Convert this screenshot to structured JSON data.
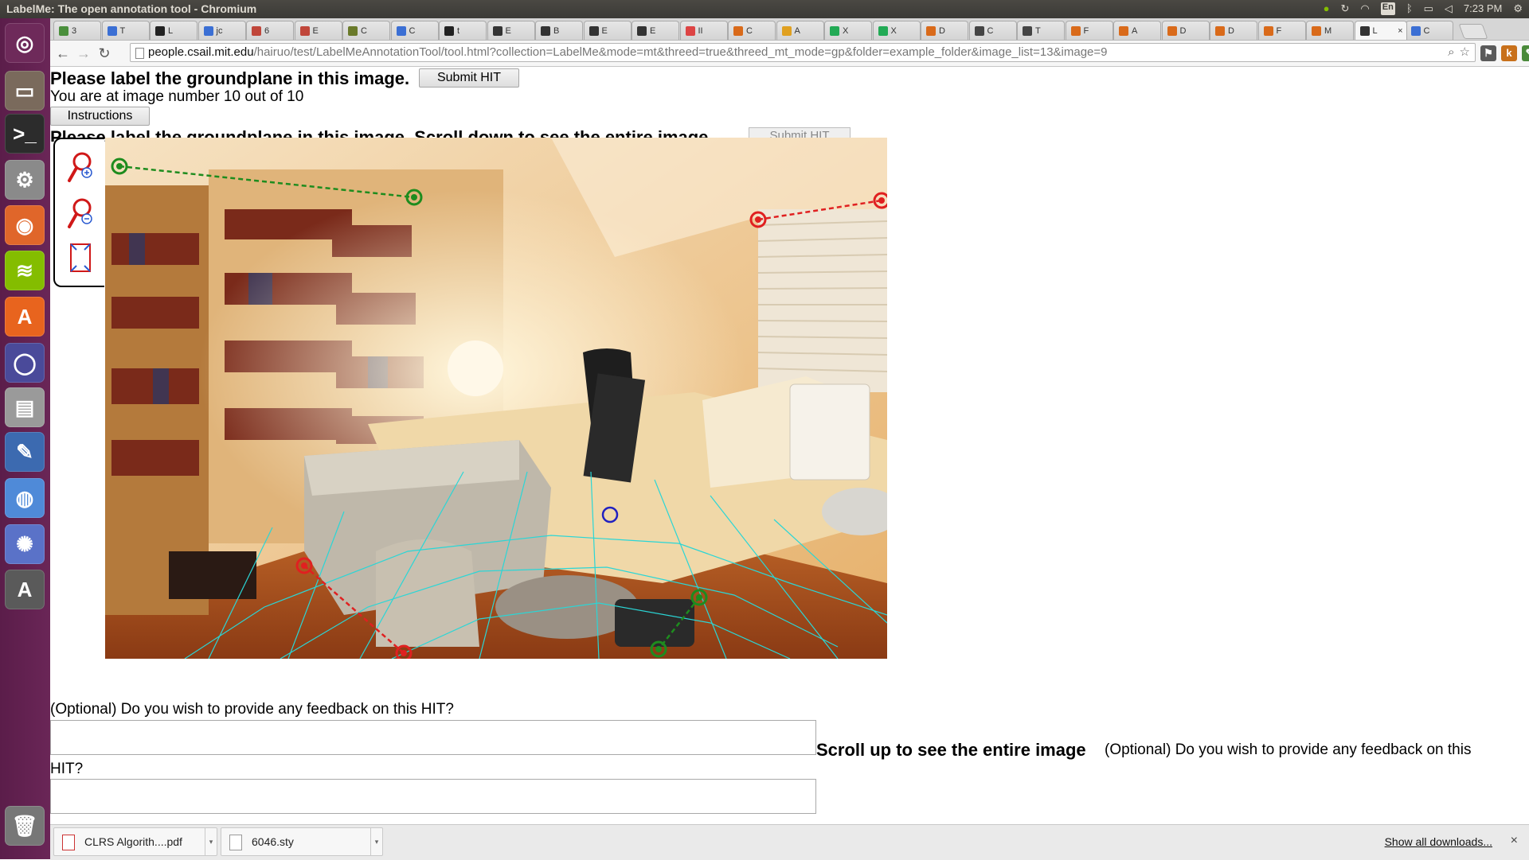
{
  "os": {
    "window_title": "LabelMe: The open annotation tool - Chromium",
    "keyboard_layout": "En",
    "clock": "7:23 PM"
  },
  "launcher": {
    "items": [
      {
        "name": "ubuntu-dash-icon",
        "glyph": "◎",
        "color": "#6e2a5a"
      },
      {
        "name": "files-icon",
        "glyph": "▭",
        "color": "#7a6a5c"
      },
      {
        "name": "terminal-icon",
        "glyph": ">_",
        "color": "#2c2c2c"
      },
      {
        "name": "settings-icon",
        "glyph": "⚙",
        "color": "#8a8a8a"
      },
      {
        "name": "firefox-icon",
        "glyph": "◉",
        "color": "#e0662a"
      },
      {
        "name": "spotify-icon",
        "glyph": "≋",
        "color": "#84bd00"
      },
      {
        "name": "software-center-icon",
        "glyph": "A",
        "color": "#e8641e"
      },
      {
        "name": "circle-app-icon",
        "glyph": "◯",
        "color": "#4a4a9a"
      },
      {
        "name": "disk-icon",
        "glyph": "▤",
        "color": "#9a9a9a"
      },
      {
        "name": "draw-app-icon",
        "glyph": "✎",
        "color": "#3c6ab0"
      },
      {
        "name": "chromium-icon",
        "glyph": "◍",
        "color": "#4f8ad8"
      },
      {
        "name": "pinwheel-icon",
        "glyph": "✺",
        "color": "#5a72c8"
      },
      {
        "name": "updater-icon",
        "glyph": "A",
        "color": "#5a5a5a"
      },
      {
        "name": "trash-icon",
        "glyph": "🗑",
        "color": "#777777"
      }
    ]
  },
  "tabs": [
    {
      "label": "3",
      "color": "#4a8f3c"
    },
    {
      "label": "T",
      "color": "#3b6fd4"
    },
    {
      "label": "L",
      "color": "#222"
    },
    {
      "label": "jc",
      "color": "#3b6fd4"
    },
    {
      "label": "6",
      "color": "#c0463a"
    },
    {
      "label": "E",
      "color": "#c0463a"
    },
    {
      "label": "C",
      "color": "#6a7a2a"
    },
    {
      "label": "C",
      "color": "#3b6fd4"
    },
    {
      "label": "t",
      "color": "#222"
    },
    {
      "label": "E",
      "color": "#333"
    },
    {
      "label": "B",
      "color": "#333"
    },
    {
      "label": "E",
      "color": "#333"
    },
    {
      "label": "E",
      "color": "#333"
    },
    {
      "label": "II",
      "color": "#d44"
    },
    {
      "label": "C",
      "color": "#d96a1a"
    },
    {
      "label": "A",
      "color": "#e0a020"
    },
    {
      "label": "X",
      "color": "#2a5"
    },
    {
      "label": "X",
      "color": "#2a5"
    },
    {
      "label": "D",
      "color": "#d96a1a"
    },
    {
      "label": "C",
      "color": "#444"
    },
    {
      "label": "T",
      "color": "#444"
    },
    {
      "label": "F",
      "color": "#d96a1a"
    },
    {
      "label": "A",
      "color": "#d96a1a"
    },
    {
      "label": "D",
      "color": "#d96a1a"
    },
    {
      "label": "D",
      "color": "#d96a1a"
    },
    {
      "label": "F",
      "color": "#d96a1a"
    },
    {
      "label": "M",
      "color": "#d96a1a"
    },
    {
      "label": "L",
      "color": "#333",
      "active": true
    },
    {
      "label": "C",
      "color": "#3b6fd4"
    }
  ],
  "active_tab_close": "×",
  "omnibox": {
    "host": "people.csail.mit.edu",
    "path": "/hairuo/test/LabelMeAnnotationTool/tool.html?collection=LabelMe&mode=mt&threed=true&threed_mt_mode=gp&folder=example_folder&image_list=13&image=9"
  },
  "page": {
    "heading": "Please label the groundplane in this image.",
    "submit_label": "Submit HIT",
    "image_counter": "You are at image number 10 out of 10",
    "instructions_label": "Instructions",
    "heading_scroll": "Please label the groundplane in this image. Scroll down to see the entire image.",
    "submit_label_2": "Submit HIT",
    "feedback_prompt": "(Optional) Do you wish to provide any feedback on this HIT?",
    "scroll_up": "Scroll up to see the entire image",
    "feedback_prompt_inline": "(Optional) Do you wish to provide any feedback on this",
    "feedback_prompt_tail": "HIT?"
  },
  "tools": [
    {
      "name": "zoom-in-icon"
    },
    {
      "name": "zoom-out-icon"
    },
    {
      "name": "fit-image-icon"
    }
  ],
  "downloads": {
    "items": [
      {
        "filename": "CLRS Algorith....pdf",
        "type": "pdf"
      },
      {
        "filename": "6046.sty",
        "type": "file"
      }
    ],
    "show_all": "Show all downloads...",
    "close": "×"
  },
  "colors": {
    "plane_line": "#2a8a2a",
    "control_red": "#e02020",
    "control_green": "#1e8c1e",
    "grid_cyan": "#2ad6d6",
    "active_point": "#2020c0"
  }
}
